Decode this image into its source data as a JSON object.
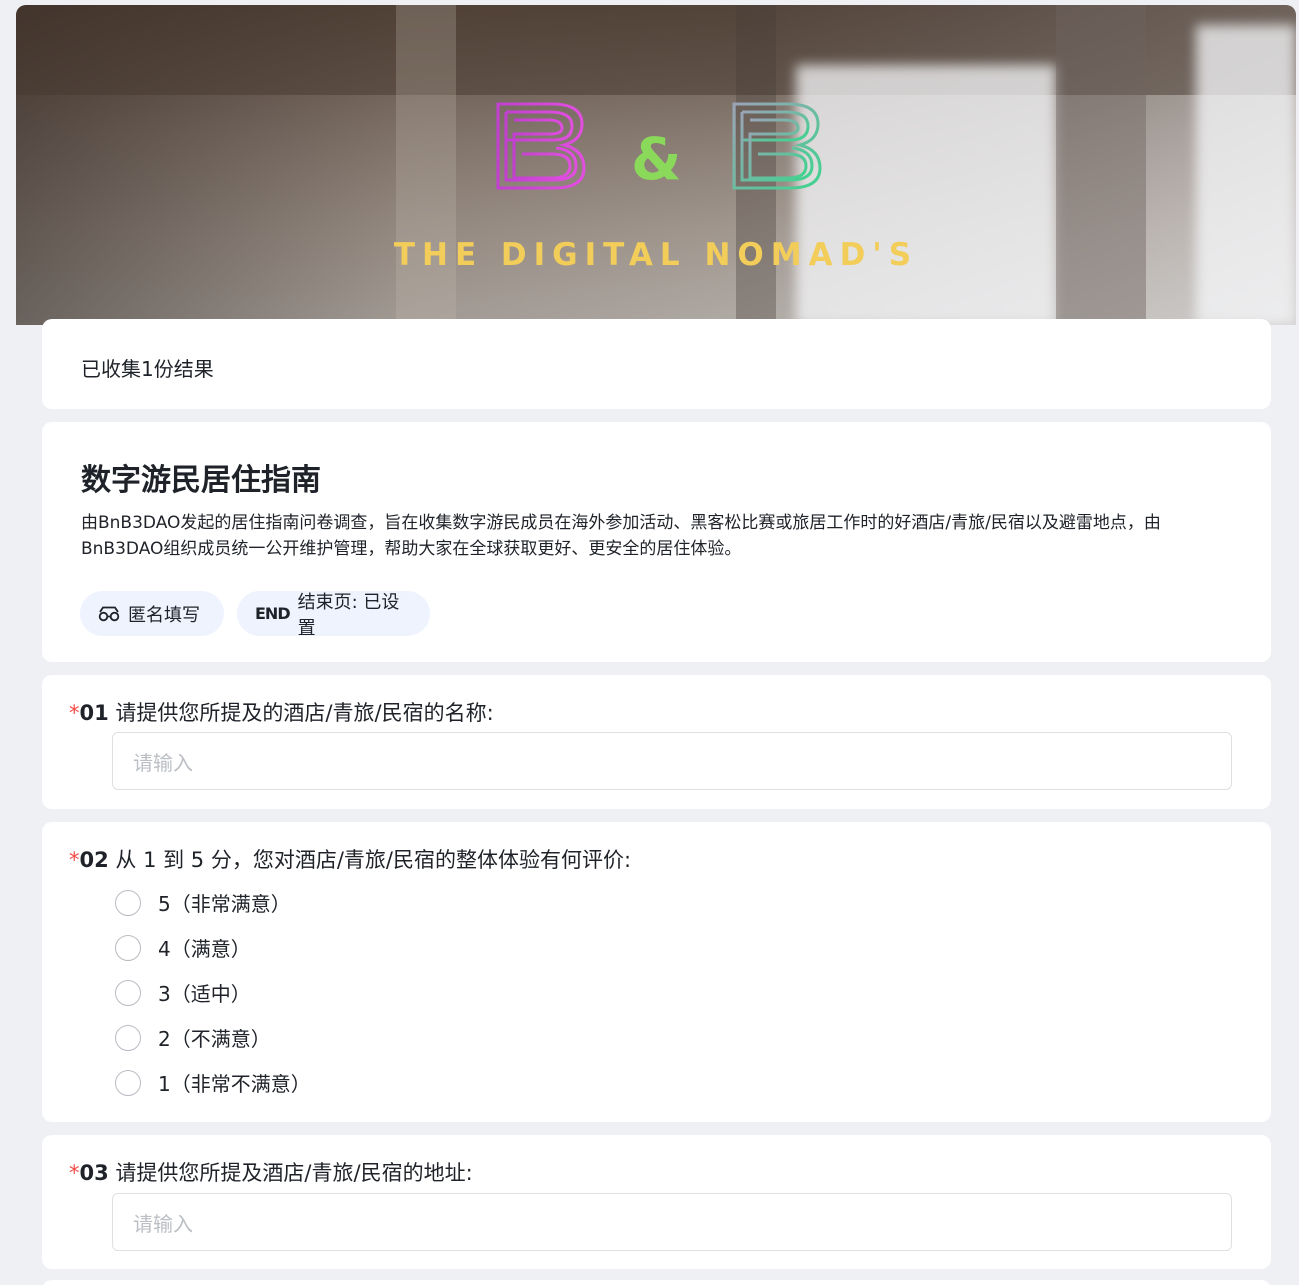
{
  "banner": {
    "logo_left": "B",
    "logo_amp": "&",
    "logo_right": "B",
    "tagline": "THE DIGITAL NOMAD'S"
  },
  "summary": {
    "collected_text": "已收集1份结果"
  },
  "survey": {
    "title": "数字游民居住指南",
    "description": "由BnB3DAO发起的居住指南问卷调查，旨在收集数字游民成员在海外参加活动、黑客松比赛或旅居工作时的好酒店/青旅/民宿以及避雷地点，由BnB3DAO组织成员统一公开维护管理，帮助大家在全球获取更好、更安全的居住体验。",
    "tags": {
      "anonymous": "匿名填写",
      "end_icon": "END",
      "end_page": "结束页: 已设置"
    }
  },
  "questions": {
    "q1": {
      "required": "*",
      "number": "01",
      "text": "请提供您所提及的酒店/青旅/民宿的名称:",
      "placeholder": "请输入"
    },
    "q2": {
      "required": "*",
      "number": "02",
      "text": "从 1 到 5 分，您对酒店/青旅/民宿的整体体验有何评价:",
      "options": [
        "5（非常满意）",
        "4（满意）",
        "3（适中）",
        "2（不满意）",
        "1（非常不满意）"
      ]
    },
    "q3": {
      "required": "*",
      "number": "03",
      "text": "请提供您所提及酒店/青旅/民宿的地址:",
      "placeholder": "请输入"
    }
  },
  "colors": {
    "required": "#f54a45",
    "tagline": "#f2cd5a",
    "tag_bg": "#eef3fd"
  },
  "icons": [
    "anonymous-glasses-icon",
    "end-icon",
    "radio-icon"
  ]
}
